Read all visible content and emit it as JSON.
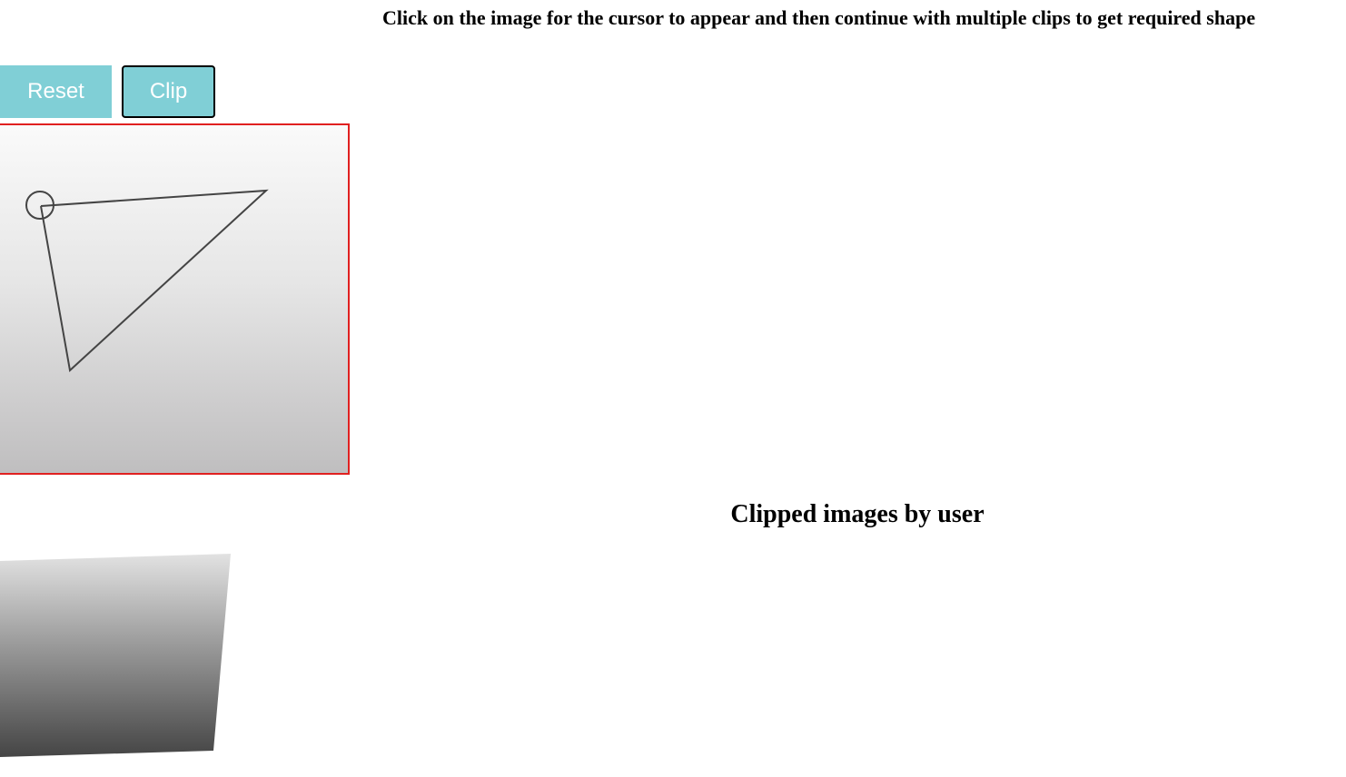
{
  "instruction": "Click on the image for the cursor to appear and then continue with multiple clips to get required shape",
  "toolbar": {
    "reset_label": "Reset",
    "clip_label": "Clip"
  },
  "clipped_section": {
    "heading": "Clipped images by user"
  },
  "colors": {
    "button_bg": "#80cfd6",
    "button_text": "#ffffff",
    "canvas_border": "#e02020",
    "polyline": "#444444"
  }
}
